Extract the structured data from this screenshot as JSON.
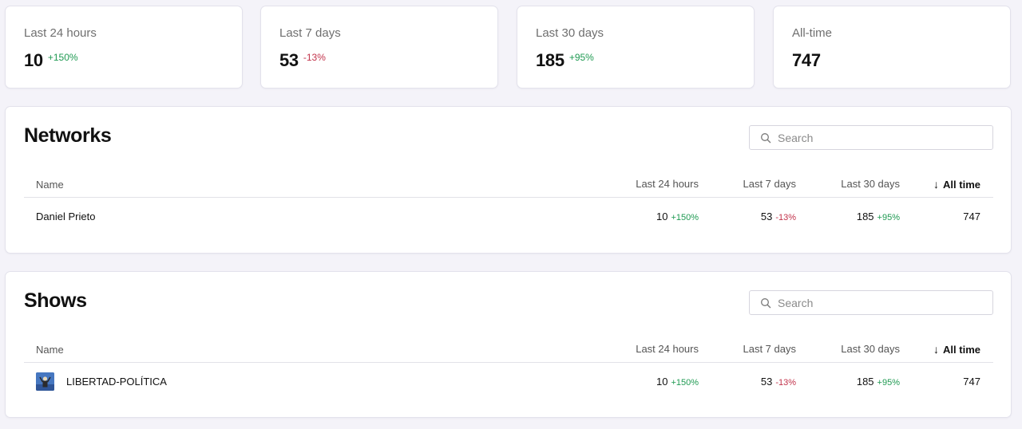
{
  "stats": [
    {
      "label": "Last 24 hours",
      "value": "10",
      "change": "+150%",
      "trend": "positive"
    },
    {
      "label": "Last 7 days",
      "value": "53",
      "change": "-13%",
      "trend": "negative"
    },
    {
      "label": "Last 30 days",
      "value": "185",
      "change": "+95%",
      "trend": "positive"
    },
    {
      "label": "All-time",
      "value": "747",
      "change": "",
      "trend": "none"
    }
  ],
  "networks": {
    "title": "Networks",
    "search_placeholder": "Search",
    "columns": {
      "name": "Name",
      "last24": "Last 24 hours",
      "last7": "Last 7 days",
      "last30": "Last 30 days",
      "all": "All time",
      "sort_arrow": "↓"
    },
    "rows": [
      {
        "name": "Daniel Prieto",
        "last24": "10",
        "last24_change": "+150%",
        "last7": "53",
        "last7_change": "-13%",
        "last30": "185",
        "last30_change": "+95%",
        "all": "747"
      }
    ]
  },
  "shows": {
    "title": "Shows",
    "search_placeholder": "Search",
    "columns": {
      "name": "Name",
      "last24": "Last 24 hours",
      "last7": "Last 7 days",
      "last30": "Last 30 days",
      "all": "All time",
      "sort_arrow": "↓"
    },
    "rows": [
      {
        "name": "LIBERTAD-POLÍTICA",
        "thumbnail": "show-cover-image",
        "last24": "10",
        "last24_change": "+150%",
        "last7": "53",
        "last7_change": "-13%",
        "last30": "185",
        "last30_change": "+95%",
        "all": "747"
      }
    ]
  },
  "colors": {
    "background": "#f4f3f9",
    "positive": "#1f9a52",
    "negative": "#c2334b",
    "card": "#ffffff"
  },
  "icons": {
    "search": "search-icon",
    "sort": "sort-down-arrow-icon"
  }
}
